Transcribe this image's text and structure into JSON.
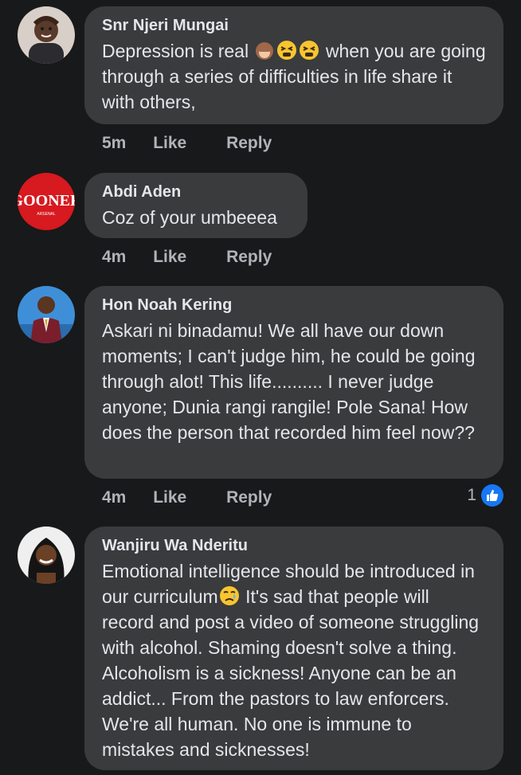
{
  "comments": [
    {
      "author": "Snr Njeri Mungai",
      "text_before": "Depression is real ",
      "emojis": [
        "see-no-evil-monkey",
        "tired-face",
        "tired-face"
      ],
      "text_after": " when you are going through a series of difficulties in life share it with others,",
      "time": "5m",
      "like": "Like",
      "reply": "Reply"
    },
    {
      "author": "Abdi Aden",
      "text": "Coz of your umbeeea",
      "avatar_text": "GOONER",
      "avatar_subtext": "ARSENAL",
      "time": "4m",
      "like": "Like",
      "reply": "Reply"
    },
    {
      "author": "Hon Noah Kering",
      "text": "Askari ni binadamu! We all have our down moments; I can't judge him, he could be going through alot! This life.......... I never judge anyone; Dunia rangi rangile! Pole Sana! How does the person that recorded him feel now??",
      "time": "4m",
      "like": "Like",
      "reply": "Reply",
      "reaction_count": "1"
    },
    {
      "author": "Wanjiru Wa Nderitu",
      "text_before": "Emotional intelligence should be introduced in our curriculum",
      "emoji": "sad-relieved-face",
      "text_after": " It's sad that people will record and post a video of someone struggling with alcohol. Shaming doesn't solve a thing. Alcoholism is a sickness! Anyone can be an addict... From the pastors to law enforcers. We're all human. No one is immune to mistakes and sicknesses!"
    }
  ],
  "colors": {
    "background": "#18191a",
    "bubble": "#3a3b3c",
    "text": "#e4e6eb",
    "secondary": "#b0b3b8",
    "like_blue": "#1877f2",
    "gooner_red": "#d71920"
  }
}
